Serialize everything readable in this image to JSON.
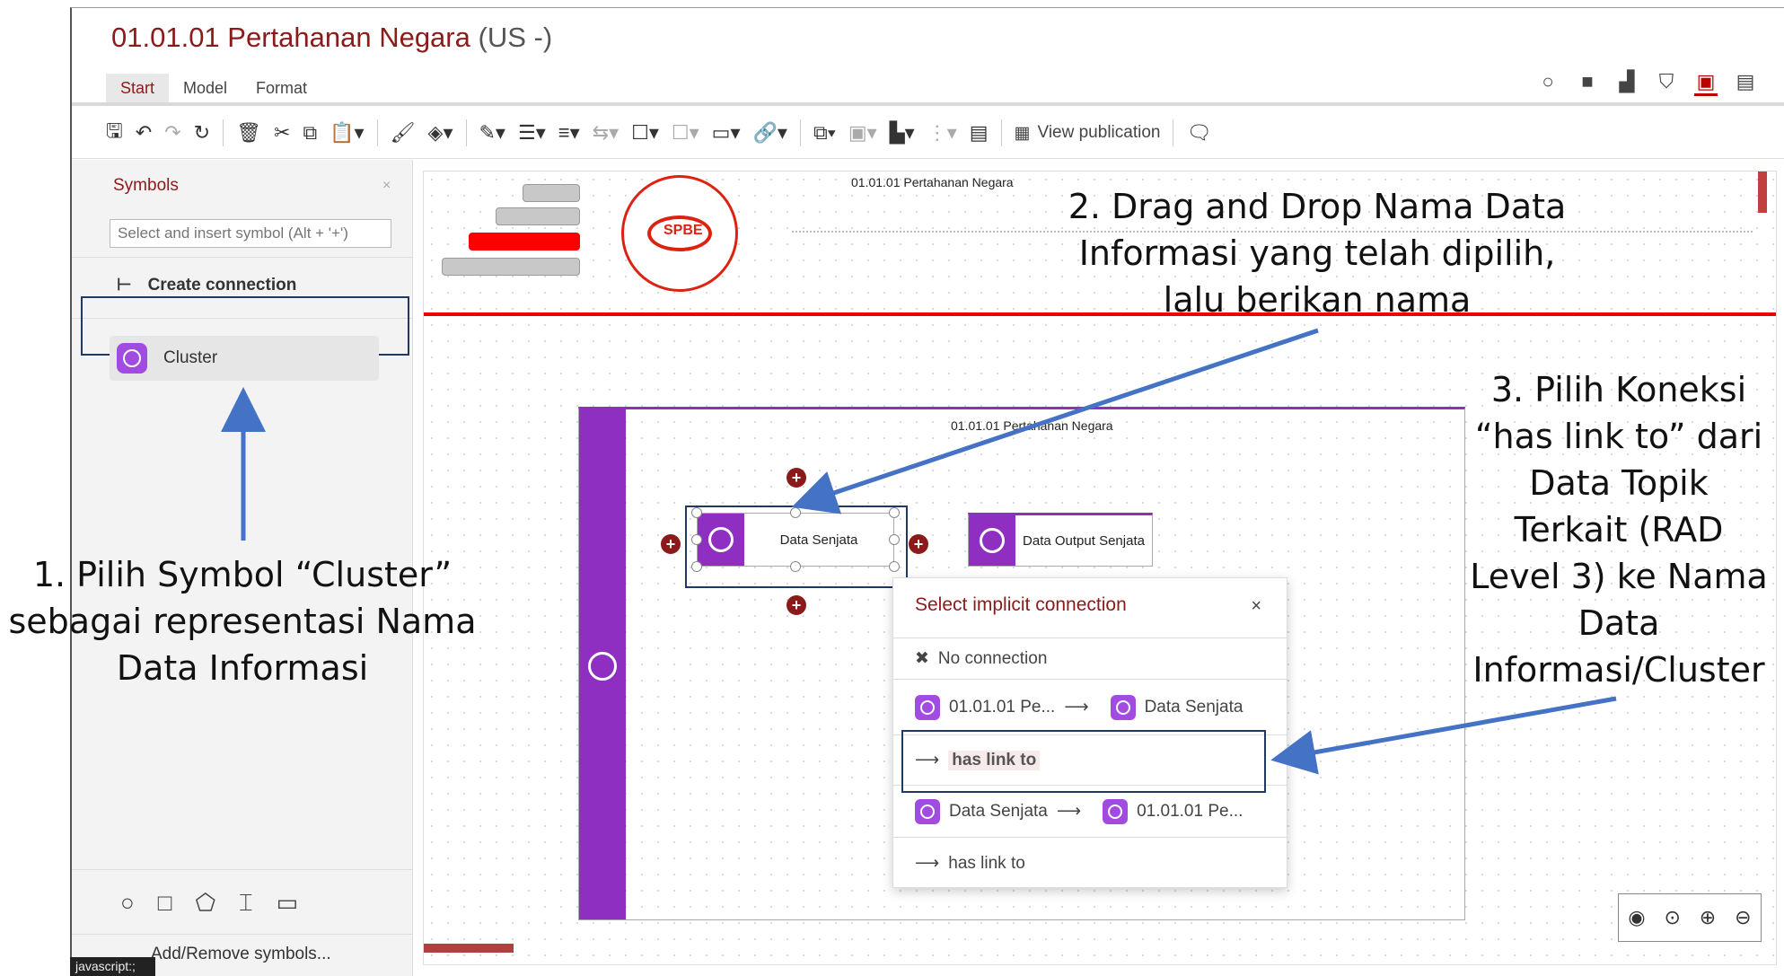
{
  "header": {
    "title": "01.01.01 Pertahanan Negara",
    "lang": "(US -)"
  },
  "tabs": [
    "Start",
    "Model",
    "Format"
  ],
  "toolbar": {
    "view_publication": "View publication"
  },
  "sidebar": {
    "title": "Symbols",
    "close": "×",
    "search_placeholder": "Select and insert symbol (Alt + '+')",
    "create_connection": "Create connection",
    "cluster": "Cluster",
    "add_remove": "Add/Remove symbols..."
  },
  "status": "javascript:;",
  "canvas": {
    "header_title": "01.01.01 Pertahanan Negara",
    "logo_text": "SPBE",
    "pool_title": "01.01.01 Pertahanan Negara",
    "node_1": "Data Senjata",
    "node_2": "Data Output Senjata"
  },
  "popup": {
    "title": "Select implicit connection",
    "close": "×",
    "no_connection": "No connection",
    "r1_from": "01.01.01 Pe...",
    "r1_to": "Data Senjata",
    "r1_link": "has link to",
    "r2_from": "Data Senjata",
    "r2_to": "01.01.01 Pe...",
    "r2_link": "has link to"
  },
  "annotations": {
    "a1_l1": "1. Pilih Symbol “Cluster”",
    "a1_l2": "sebagai representasi Nama",
    "a1_l3": "Data Informasi",
    "a2_l1": "2. Drag and Drop Nama Data",
    "a2_l2": "Informasi yang telah dipilih,",
    "a2_l3": "lalu berikan nama",
    "a3_l1": "3. Pilih Koneksi",
    "a3_l2": "“has link to” dari",
    "a3_l3": "Data Topik",
    "a3_l4": "Terkait (RAD",
    "a3_l5": "Level 3) ke Nama",
    "a3_l6": "Data",
    "a3_l7": "Informasi/Cluster"
  },
  "colors": {
    "brand": "#8b1a1a",
    "cluster": "#8e2fc2",
    "annotation_arrow": "#4472c4"
  }
}
